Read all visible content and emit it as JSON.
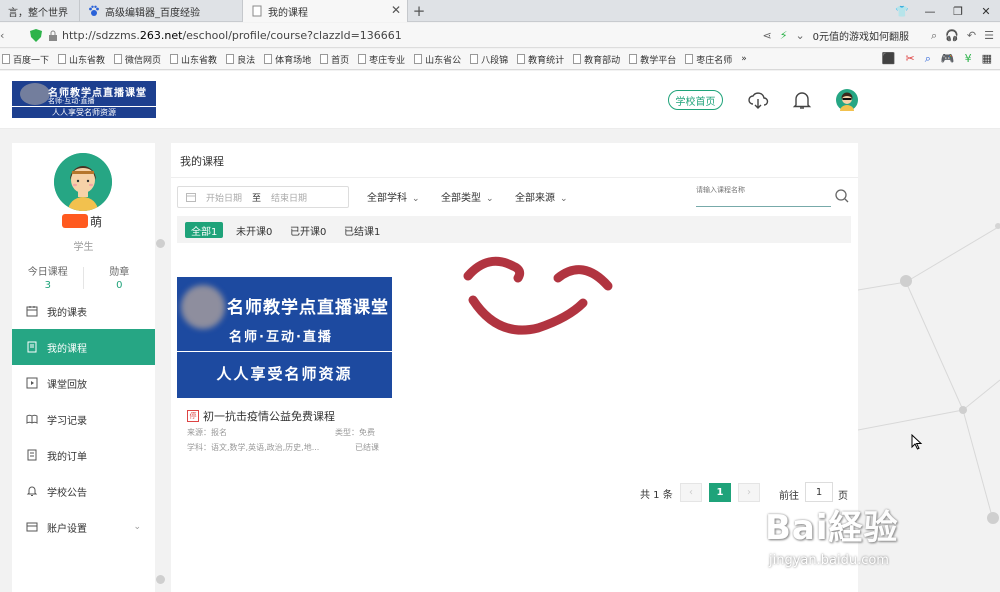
{
  "browser": {
    "tabs": [
      {
        "label": "言，整个世界",
        "active": false
      },
      {
        "label": "高级编辑器_百度经验",
        "active": false
      },
      {
        "label": "我的课程",
        "active": true
      }
    ],
    "new_tab": "+",
    "url_prefix": "http://sdzzms.",
    "url_domain": "263.net",
    "url_path": "/eschool/profile/course?clazzId=136661",
    "address_hint": "0元值的游戏如何翻服",
    "bookmarks": [
      "百度一下",
      "山东省教",
      "微信网页",
      "山东省教",
      "良法",
      "体育场地",
      "首页",
      "枣庄专业",
      "山东省公",
      "八段锦",
      "教育统计",
      "教育部动",
      "教学平台",
      "枣庄名师"
    ],
    "bookmarks_more": "»"
  },
  "header": {
    "logo_line1": "名师教学点直播课堂",
    "logo_line2": "名师·互动·直播",
    "logo_line3": "人人享受名师资源",
    "home_button": "学校首页"
  },
  "profile": {
    "name_suffix": "萌",
    "role": "学生",
    "stats": [
      {
        "label": "今日课程",
        "value": "3"
      },
      {
        "label": "勋章",
        "value": "0"
      }
    ]
  },
  "menu": [
    {
      "label": "我的课表",
      "icon": "calendar-icon",
      "active": false
    },
    {
      "label": "我的课程",
      "icon": "book-icon",
      "active": true
    },
    {
      "label": "课堂回放",
      "icon": "replay-icon",
      "active": false
    },
    {
      "label": "学习记录",
      "icon": "open-book-icon",
      "active": false
    },
    {
      "label": "我的订单",
      "icon": "order-icon",
      "active": false
    },
    {
      "label": "学校公告",
      "icon": "bell-icon",
      "active": false
    },
    {
      "label": "账户设置",
      "icon": "settings-icon",
      "active": false,
      "expandable": true
    }
  ],
  "main": {
    "title": "我的课程",
    "date_start_placeholder": "开始日期",
    "date_sep": "至",
    "date_end_placeholder": "结束日期",
    "dropdowns": [
      "全部学科",
      "全部类型",
      "全部来源"
    ],
    "search_placeholder": "请输入课程名称",
    "filters": [
      {
        "label": "全部1",
        "active": true
      },
      {
        "label": "未开课0",
        "active": false
      },
      {
        "label": "已开课0",
        "active": false
      },
      {
        "label": "已结课1",
        "active": false
      }
    ]
  },
  "course": {
    "banner_line1": "名师教学点直播课堂",
    "banner_line2": "名师·互动·直播",
    "banner_line3": "人人享受名师资源",
    "tag": "停",
    "name": "初一抗击疫情公益免费课程",
    "source": "来源：报名",
    "type": "类型：免费",
    "subjects": "学科：语文,数学,英语,政治,历史,地...",
    "status": "已结课"
  },
  "pagination": {
    "total": "共 1 条",
    "prev": "‹",
    "current": "1",
    "next": "›",
    "goto_label": "前往",
    "goto_value": "1",
    "goto_suffix": "页"
  },
  "watermark": {
    "brand": "Bai経验",
    "url": "jingyan.baidu.com"
  },
  "colors": {
    "accent": "#1fa37a",
    "menu_active": "#26a684",
    "banner": "#1d4aa0"
  }
}
